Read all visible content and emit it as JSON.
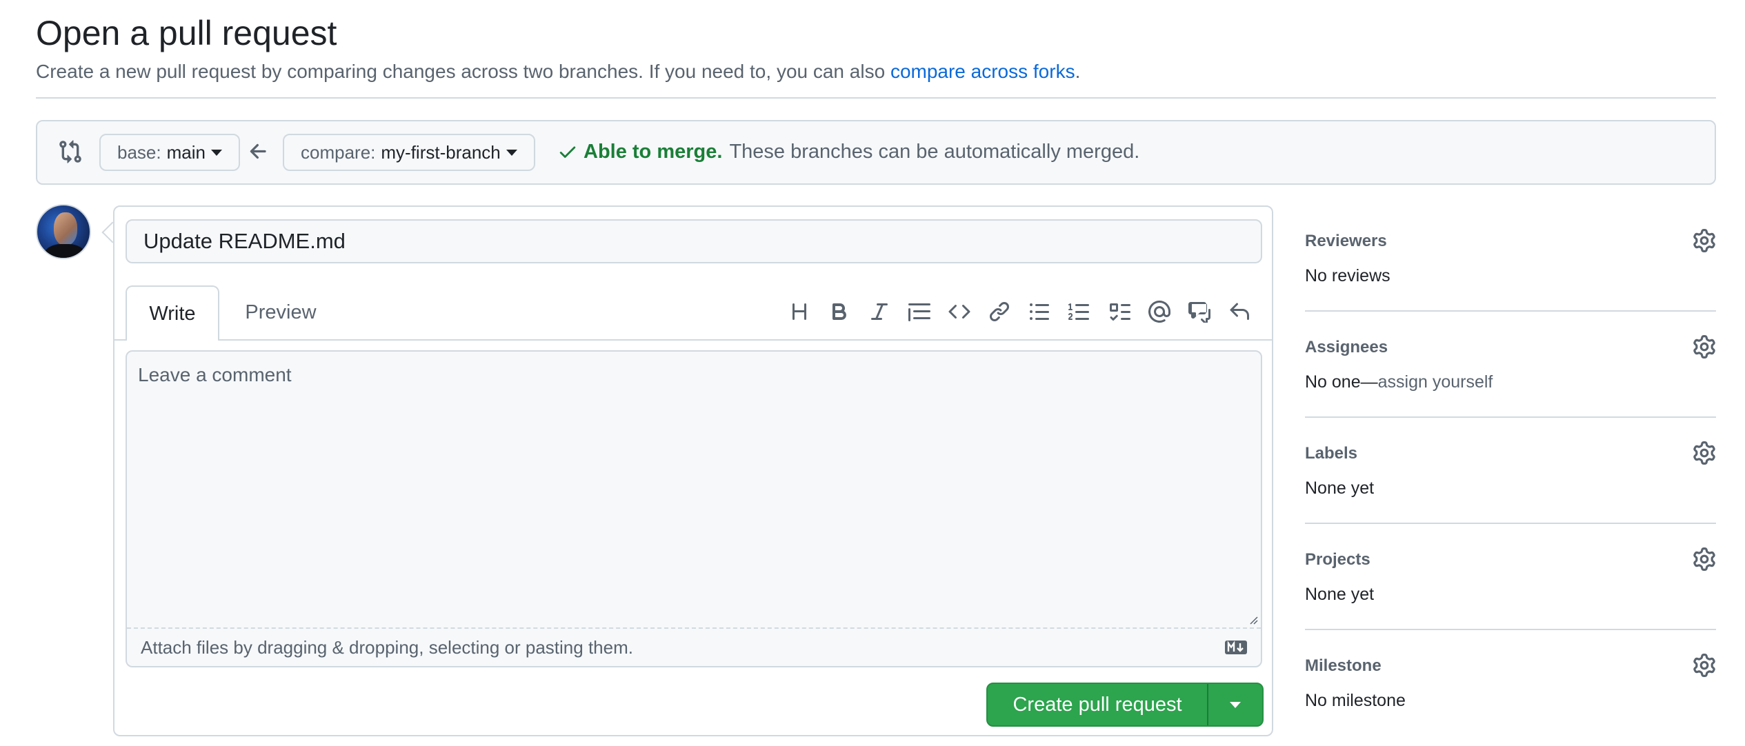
{
  "header": {
    "title": "Open a pull request",
    "subtitle_prefix": "Create a new pull request by comparing changes across two branches. If you need to, you can also ",
    "subtitle_link": "compare across forks",
    "subtitle_suffix": "."
  },
  "compare_bar": {
    "base_label": "base:",
    "base_value": "main",
    "compare_label": "compare:",
    "compare_value": "my-first-branch",
    "merge_ok": "Able to merge.",
    "merge_message": "These branches can be automatically merged."
  },
  "form": {
    "title_value": "Update README.md",
    "tabs": {
      "write": "Write",
      "preview": "Preview"
    },
    "comment_placeholder": "Leave a comment",
    "attach_text": "Attach files by dragging & dropping, selecting or pasting them.",
    "create_label": "Create pull request"
  },
  "toolbar_icons": [
    "heading-icon",
    "bold-icon",
    "italic-icon",
    "quote-icon",
    "code-icon",
    "link-icon",
    "unordered-list-icon",
    "ordered-list-icon",
    "task-list-icon",
    "mention-icon",
    "cross-reference-icon",
    "reply-icon"
  ],
  "sidebar": {
    "reviewers": {
      "label": "Reviewers",
      "value": "No reviews"
    },
    "assignees": {
      "label": "Assignees",
      "value": "No one—",
      "link": "assign yourself"
    },
    "labels": {
      "label": "Labels",
      "value": "None yet"
    },
    "projects": {
      "label": "Projects",
      "value": "None yet"
    },
    "milestone": {
      "label": "Milestone",
      "value": "No milestone"
    }
  },
  "colors": {
    "accent_link": "#0969da",
    "success": "#1a7f37",
    "button_green": "#2da44e",
    "border": "#d1d9e0",
    "muted": "#59636e"
  }
}
